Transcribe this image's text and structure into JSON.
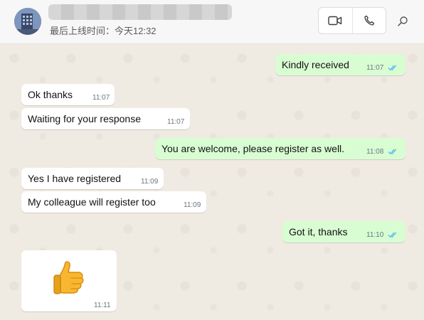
{
  "header": {
    "contact_name": "███████████████",
    "last_seen": "最后上线时间：今天12:32",
    "icons": {
      "video": "video-camera-icon",
      "call": "phone-icon",
      "search": "search-icon"
    }
  },
  "colors": {
    "incoming": "#ffffff",
    "outgoing": "#d9fdd3",
    "read_tick": "#53bdeb",
    "background": "#efeae2"
  },
  "messages": [
    {
      "direction": "out",
      "text": "Kindly received",
      "time": "11:07",
      "status": "read"
    },
    {
      "direction": "in",
      "text": "Ok thanks",
      "time": "11:07"
    },
    {
      "direction": "in",
      "text": "Waiting for your response",
      "time": "11:07"
    },
    {
      "direction": "out",
      "text": "You are welcome, please register as well.",
      "time": "11:08",
      "status": "read"
    },
    {
      "direction": "in",
      "text": "Yes I have registered",
      "time": "11:09"
    },
    {
      "direction": "in",
      "text": "My colleague will register too",
      "time": "11:09"
    },
    {
      "direction": "out",
      "text": "Got it, thanks",
      "time": "11:10",
      "status": "read"
    },
    {
      "direction": "in",
      "text": "👍",
      "time": "11:11",
      "type": "emoji",
      "emoji_name": "thumbs-up-icon"
    }
  ]
}
